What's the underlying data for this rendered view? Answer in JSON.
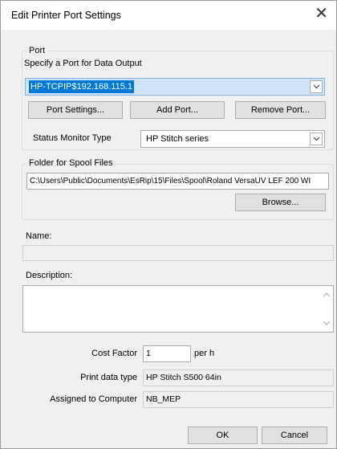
{
  "window": {
    "title": "Edit Printer Port Settings",
    "close_glyph": "✕"
  },
  "port": {
    "legend": "Port",
    "caption": "Specify a Port for Data Output",
    "selected_port": "HP-TCPIP$192.168.115.1",
    "buttons": {
      "port_settings": "Port Settings...",
      "add_port": "Add Port...",
      "remove_port": "Remove Port..."
    },
    "status_monitor_label": "Status Monitor Type",
    "status_monitor_value": "HP Stitch series"
  },
  "spool": {
    "legend": "Folder for Spool Files",
    "path": "C:\\Users\\Public\\Documents\\EsRip\\15\\Files\\Spool\\Roland VersaUV LEF 200 WI",
    "browse": "Browse..."
  },
  "name": {
    "label": "Name:",
    "value": ""
  },
  "description": {
    "label": "Description:",
    "value": ""
  },
  "cost": {
    "label": "Cost Factor",
    "value": "1",
    "unit": "per h"
  },
  "print_data_type": {
    "label": "Print data type",
    "value": "HP Stitch S500 64in"
  },
  "assigned": {
    "label": "Assigned to Computer",
    "value": "NB_MEP"
  },
  "footer": {
    "ok": "OK",
    "cancel": "Cancel"
  },
  "icons": {
    "dropdown": "chevron-down-icon",
    "scroll_up": "scroll-up-icon",
    "scroll_down": "scroll-down-icon"
  }
}
